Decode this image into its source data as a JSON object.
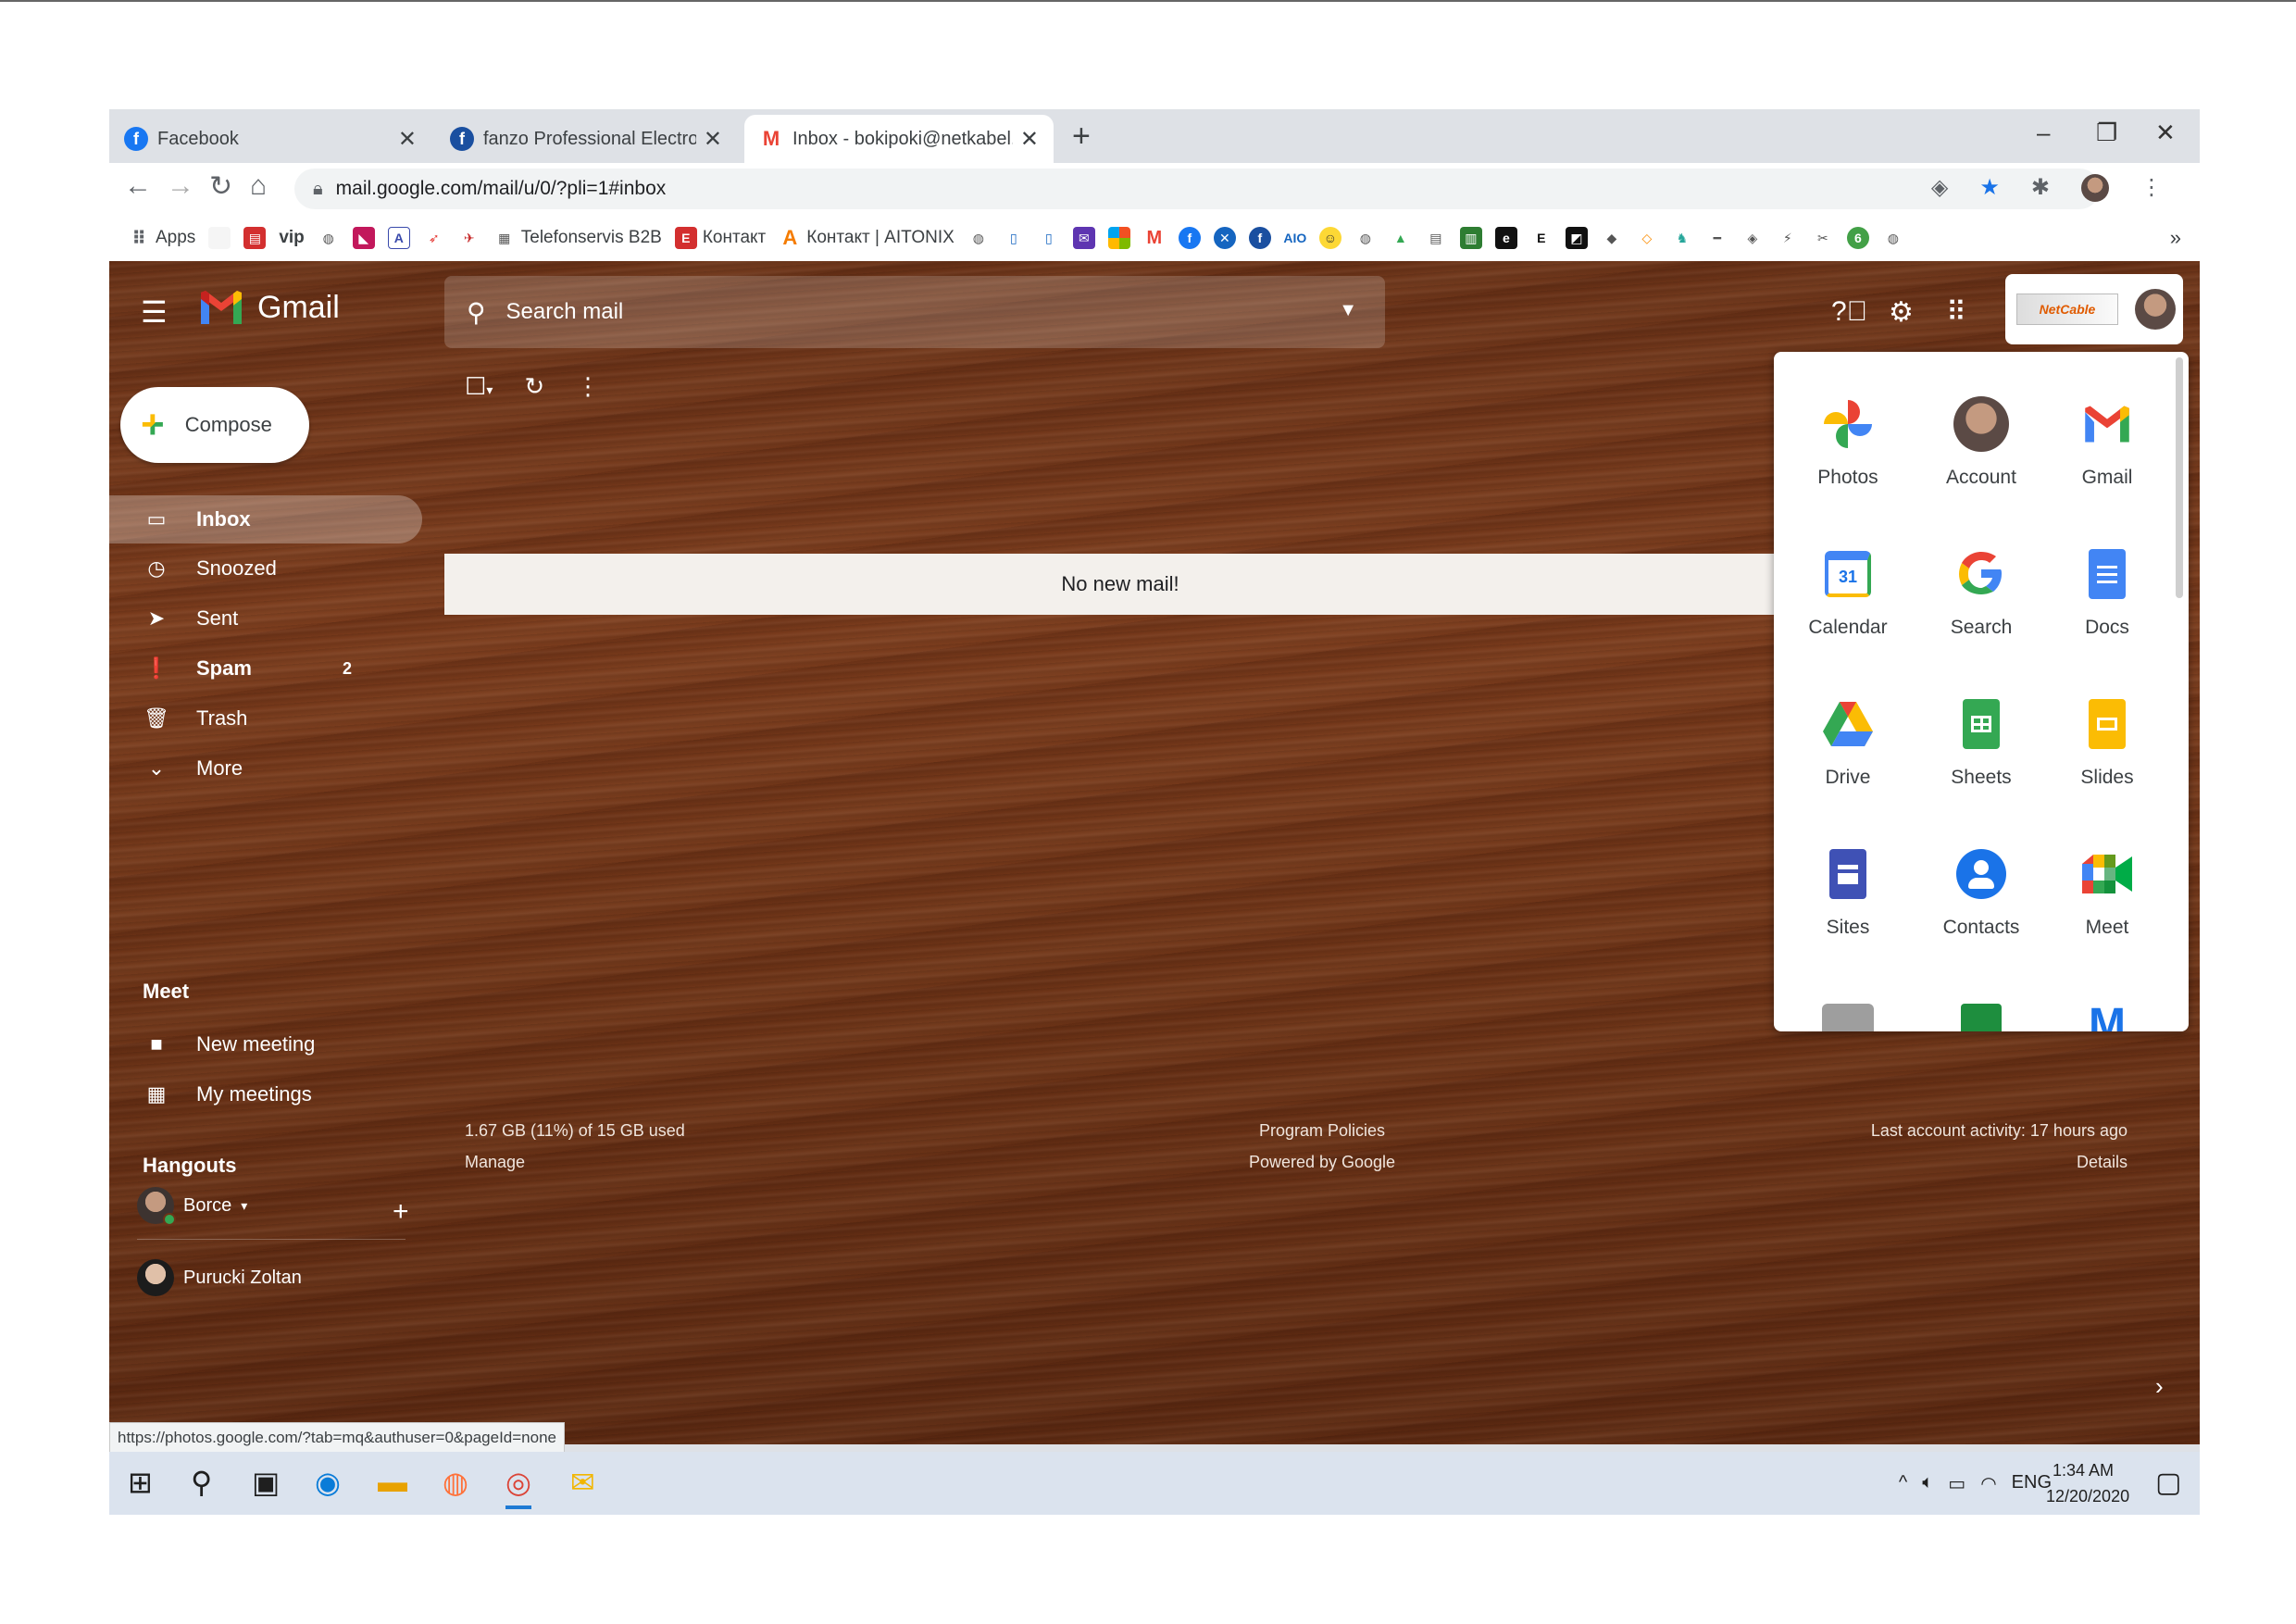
{
  "browser": {
    "tabs": [
      {
        "title": "Facebook",
        "favicon": "facebook-icon",
        "color": "#1877f2"
      },
      {
        "title": "fanzo Professional Electronics Ex",
        "favicon": "fanzo-icon",
        "color": "#1a4fa0"
      },
      {
        "title": "Inbox - bokipoki@netkabel.com.",
        "favicon": "gmail-icon",
        "color": "#ea4335"
      }
    ],
    "new_tab": "+",
    "url": "mail.google.com/mail/u/0/?pli=1#inbox",
    "bookmarks": [
      {
        "label": "Apps"
      },
      {
        "label": "vip"
      },
      {
        "label": "Telefonservis B2B"
      },
      {
        "label": "Контакт"
      },
      {
        "label": "Контакт | AITONIX"
      }
    ],
    "more": "»",
    "status_url": "https://photos.google.com/?tab=mq&authuser=0&pageId=none"
  },
  "gmail": {
    "brand": "Gmail",
    "search_placeholder": "Search mail",
    "compose": "Compose",
    "nav": [
      {
        "label": "Inbox",
        "icon": "inbox-icon"
      },
      {
        "label": "Snoozed",
        "icon": "clock-icon"
      },
      {
        "label": "Sent",
        "icon": "send-icon"
      },
      {
        "label": "Spam",
        "icon": "spam-icon",
        "count": "2"
      },
      {
        "label": "Trash",
        "icon": "trash-icon"
      },
      {
        "label": "More",
        "icon": "chevron-down-icon"
      }
    ],
    "meet": {
      "title": "Meet",
      "items": [
        "New meeting",
        "My meetings"
      ]
    },
    "hangouts": {
      "title": "Hangouts",
      "me": "Borce",
      "contacts": [
        "Purucki Zoltan"
      ]
    },
    "empty_message": "No new mail!",
    "footer": {
      "storage": "1.67 GB (11%) of 15 GB used",
      "manage": "Manage",
      "policies": "Program Policies",
      "powered": "Powered by Google",
      "activity": "Last account activity: 17 hours ago",
      "details": "Details"
    },
    "account_logo_text": "NetCable"
  },
  "apps_panel": {
    "apps": [
      "Photos",
      "Account",
      "Gmail",
      "Calendar",
      "Search",
      "Docs",
      "Drive",
      "Sheets",
      "Slides",
      "Sites",
      "Contacts",
      "Meet"
    ],
    "calendar_day": "31"
  },
  "taskbar": {
    "time": "1:34 AM",
    "date": "12/20/2020",
    "lang": "ENG"
  }
}
